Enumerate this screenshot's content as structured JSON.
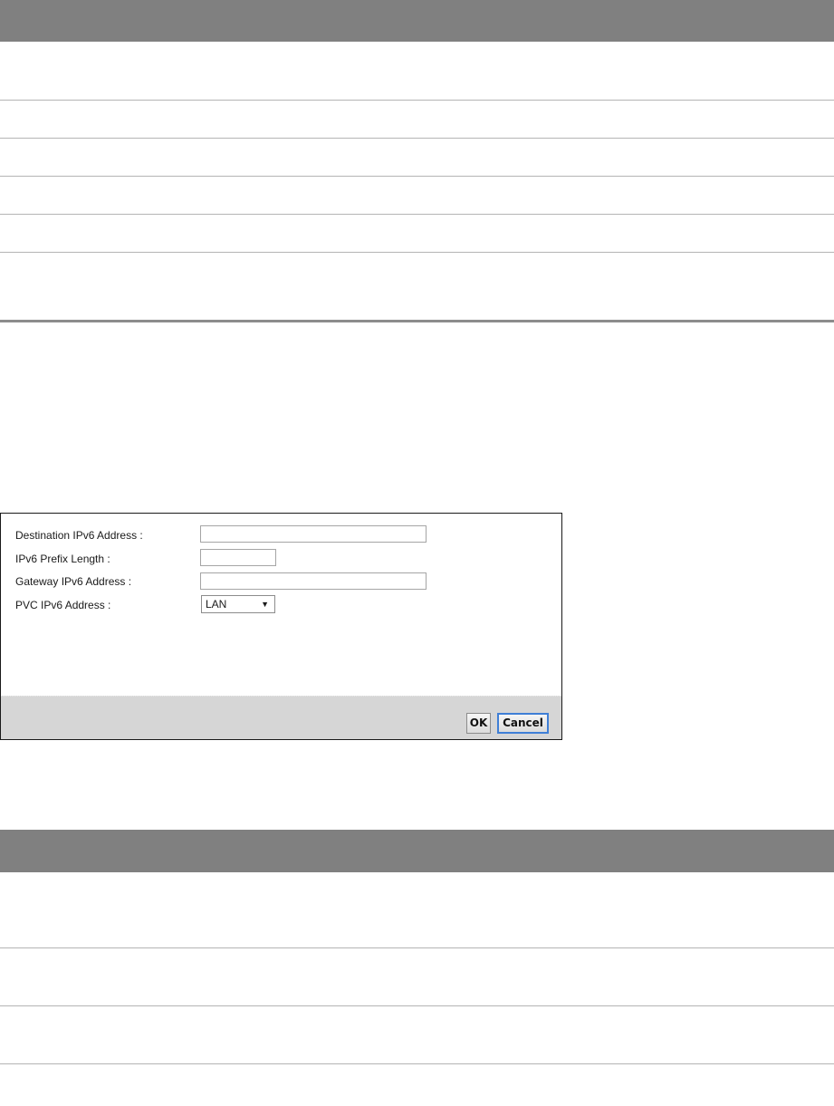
{
  "dialog": {
    "fields": [
      {
        "label": "Destination IPv6 Address :",
        "value": ""
      },
      {
        "label": "IPv6 Prefix Length :",
        "value": ""
      },
      {
        "label": "Gateway IPv6 Address :",
        "value": ""
      },
      {
        "label": "PVC IPv6 Address :",
        "selected": "LAN"
      }
    ],
    "buttons": {
      "ok": "OK",
      "cancel": "Cancel"
    }
  },
  "colors": {
    "table_header": "#808080",
    "footer": "#d6d6d6",
    "focus_border": "#3f7fd6"
  }
}
